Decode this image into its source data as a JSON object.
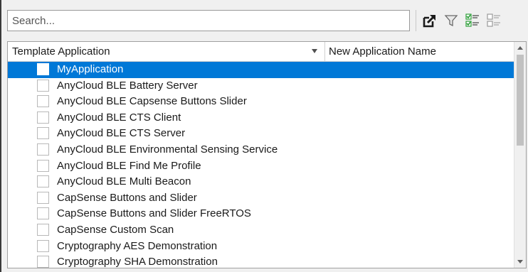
{
  "search": {
    "placeholder": "Search...",
    "value": ""
  },
  "toolbar": {
    "icons": [
      "export-icon",
      "filter-icon",
      "select-all-icon",
      "deselect-all-icon"
    ]
  },
  "table": {
    "columns": [
      "Template Application",
      "New Application Name"
    ],
    "sort_column": "Template Application",
    "selected_row": 0,
    "rows": [
      {
        "template": "MyApplication",
        "checked": false
      },
      {
        "template": "AnyCloud BLE Battery Server",
        "checked": false
      },
      {
        "template": "AnyCloud BLE Capsense Buttons Slider",
        "checked": false
      },
      {
        "template": "AnyCloud BLE CTS Client",
        "checked": false
      },
      {
        "template": "AnyCloud BLE CTS Server",
        "checked": false
      },
      {
        "template": "AnyCloud BLE Environmental Sensing Service",
        "checked": false
      },
      {
        "template": "AnyCloud BLE Find Me Profile",
        "checked": false
      },
      {
        "template": "AnyCloud BLE Multi Beacon",
        "checked": false
      },
      {
        "template": "CapSense Buttons and Slider",
        "checked": false
      },
      {
        "template": "CapSense Buttons and Slider FreeRTOS",
        "checked": false
      },
      {
        "template": "CapSense Custom Scan",
        "checked": false
      },
      {
        "template": "Cryptography AES Demonstration",
        "checked": false
      },
      {
        "template": "Cryptography SHA Demonstration",
        "checked": false
      }
    ]
  },
  "colors": {
    "selection": "#0078d7",
    "accent_green": "#2e9e3a"
  }
}
